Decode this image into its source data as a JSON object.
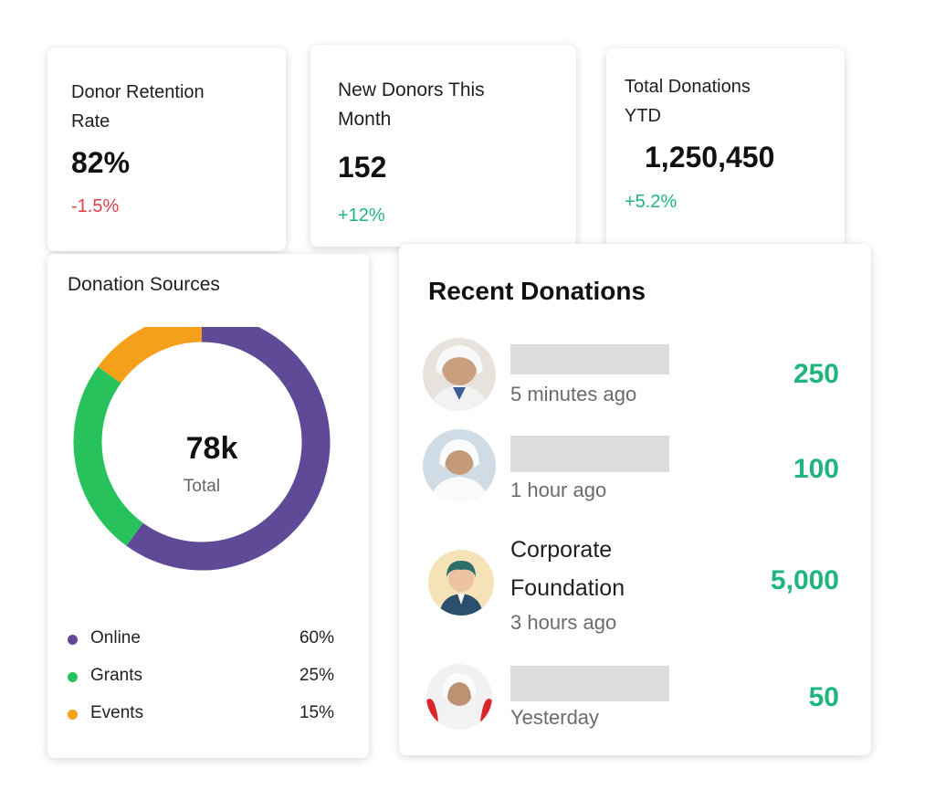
{
  "stats": [
    {
      "title": "Donor Retention\nRate",
      "value": "82%",
      "change": "-1.5%",
      "trend": "negative"
    },
    {
      "title": "New Donors This\nMonth",
      "value": "152",
      "change": "+12%",
      "trend": "positive"
    },
    {
      "title": "Total Donations\nYTD",
      "value": "1,250,450",
      "change": "+5.2%",
      "trend": "positive"
    }
  ],
  "sources": {
    "title": "Donation Sources",
    "center_value": "78k",
    "center_label": "Total",
    "items": [
      {
        "label": "Online",
        "pct": "60%",
        "value": 60,
        "color": "#5e4a96"
      },
      {
        "label": "Grants",
        "pct": "25%",
        "value": 25,
        "color": "#27c25c"
      },
      {
        "label": "Events",
        "pct": "15%",
        "value": 15,
        "color": "#f4a01b"
      }
    ]
  },
  "recent": {
    "title": "Recent Donations",
    "items": [
      {
        "name": "",
        "time": "5 minutes ago",
        "amount": "250",
        "avatar": "avatar-icon"
      },
      {
        "name": "",
        "time": "1 hour ago",
        "amount": "100",
        "avatar": "avatar-icon"
      },
      {
        "name": "Corporate\nFoundation",
        "time": "3 hours ago",
        "amount": "5,000",
        "avatar": "avatar-icon"
      },
      {
        "name": "",
        "time": "Yesterday",
        "amount": "50",
        "avatar": "avatar-icon"
      }
    ]
  },
  "colors": {
    "positive": "#1fb57d",
    "negative": "#e0414a",
    "placeholder": "#dcdcdc"
  }
}
